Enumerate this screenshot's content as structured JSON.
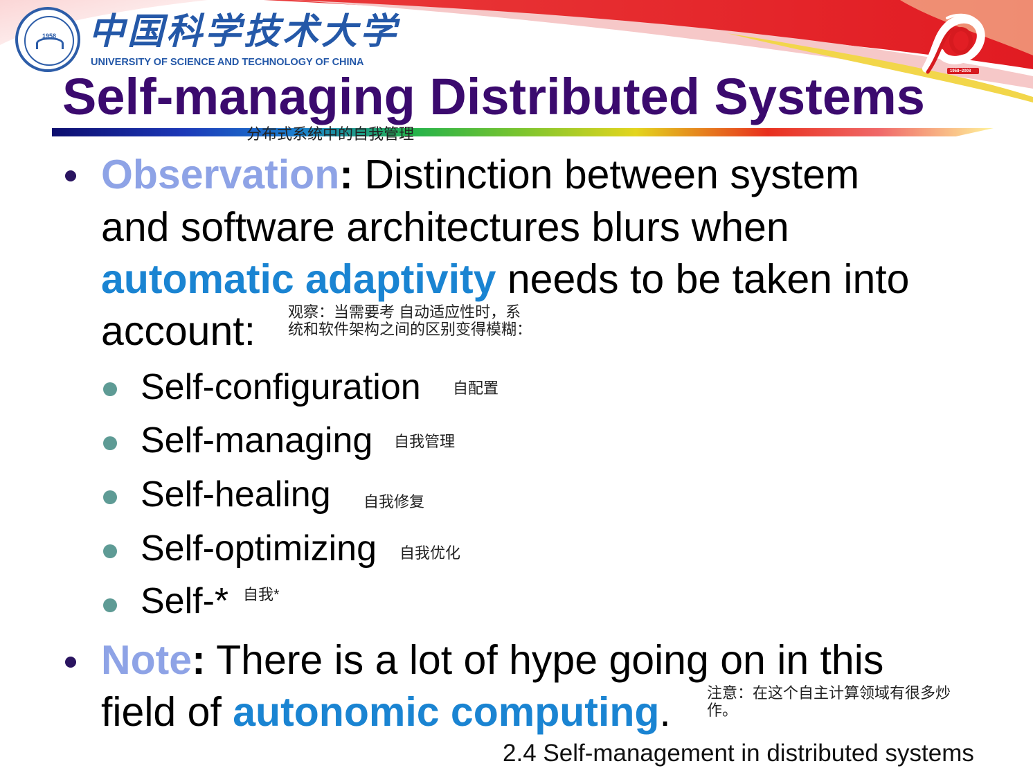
{
  "header": {
    "logo_cn": "中国科学技术大学",
    "logo_en": "UNIVERSITY OF SCIENCE AND TECHNOLOGY OF CHINA",
    "seal_year": "1958",
    "anniversary_years": "1958~2008",
    "icons": [
      "university-seal-icon",
      "50th-anniversary-emblem-icon"
    ]
  },
  "title": "Self-managing Distributed Systems",
  "title_cn": "分布式系统中的自我管理",
  "colors": {
    "title": "#3b0a6e",
    "keyword_light": "#8ea3e6",
    "keyword_blue": "#1a84d2",
    "header_red": "#e3242b",
    "logo_blue": "#2458a8"
  },
  "observation": {
    "label": "Observation",
    "colon": ":",
    "text1": " Distinction between system",
    "text2": "and software architectures blurs when",
    "highlight": "automatic adaptivity",
    "text3": " needs to be taken into",
    "text4": "account:",
    "cn_note_line1": "观察：当需要考   自动适应性时，系",
    "cn_note_line2": "统和软件架构之间的区别变得模糊："
  },
  "subitems": [
    {
      "label": "Self-configuration",
      "cn": "自配置"
    },
    {
      "label": "Self-managing",
      "cn": "自我管理"
    },
    {
      "label": "Self-healing",
      "cn": "自我修复"
    },
    {
      "label": "Self-optimizing",
      "cn": "自我优化"
    },
    {
      "label": "Self-*",
      "cn": "自我*"
    }
  ],
  "note": {
    "label": "Note",
    "colon": ":",
    "text1": " There is a lot of hype going on in this",
    "text2": "field of ",
    "highlight": "autonomic computing",
    "period": ".",
    "cn_line1": "注意：在这个自主计算领域有很多炒",
    "cn_line2": "作。"
  },
  "footer": "2.4 Self-management in distributed systems"
}
